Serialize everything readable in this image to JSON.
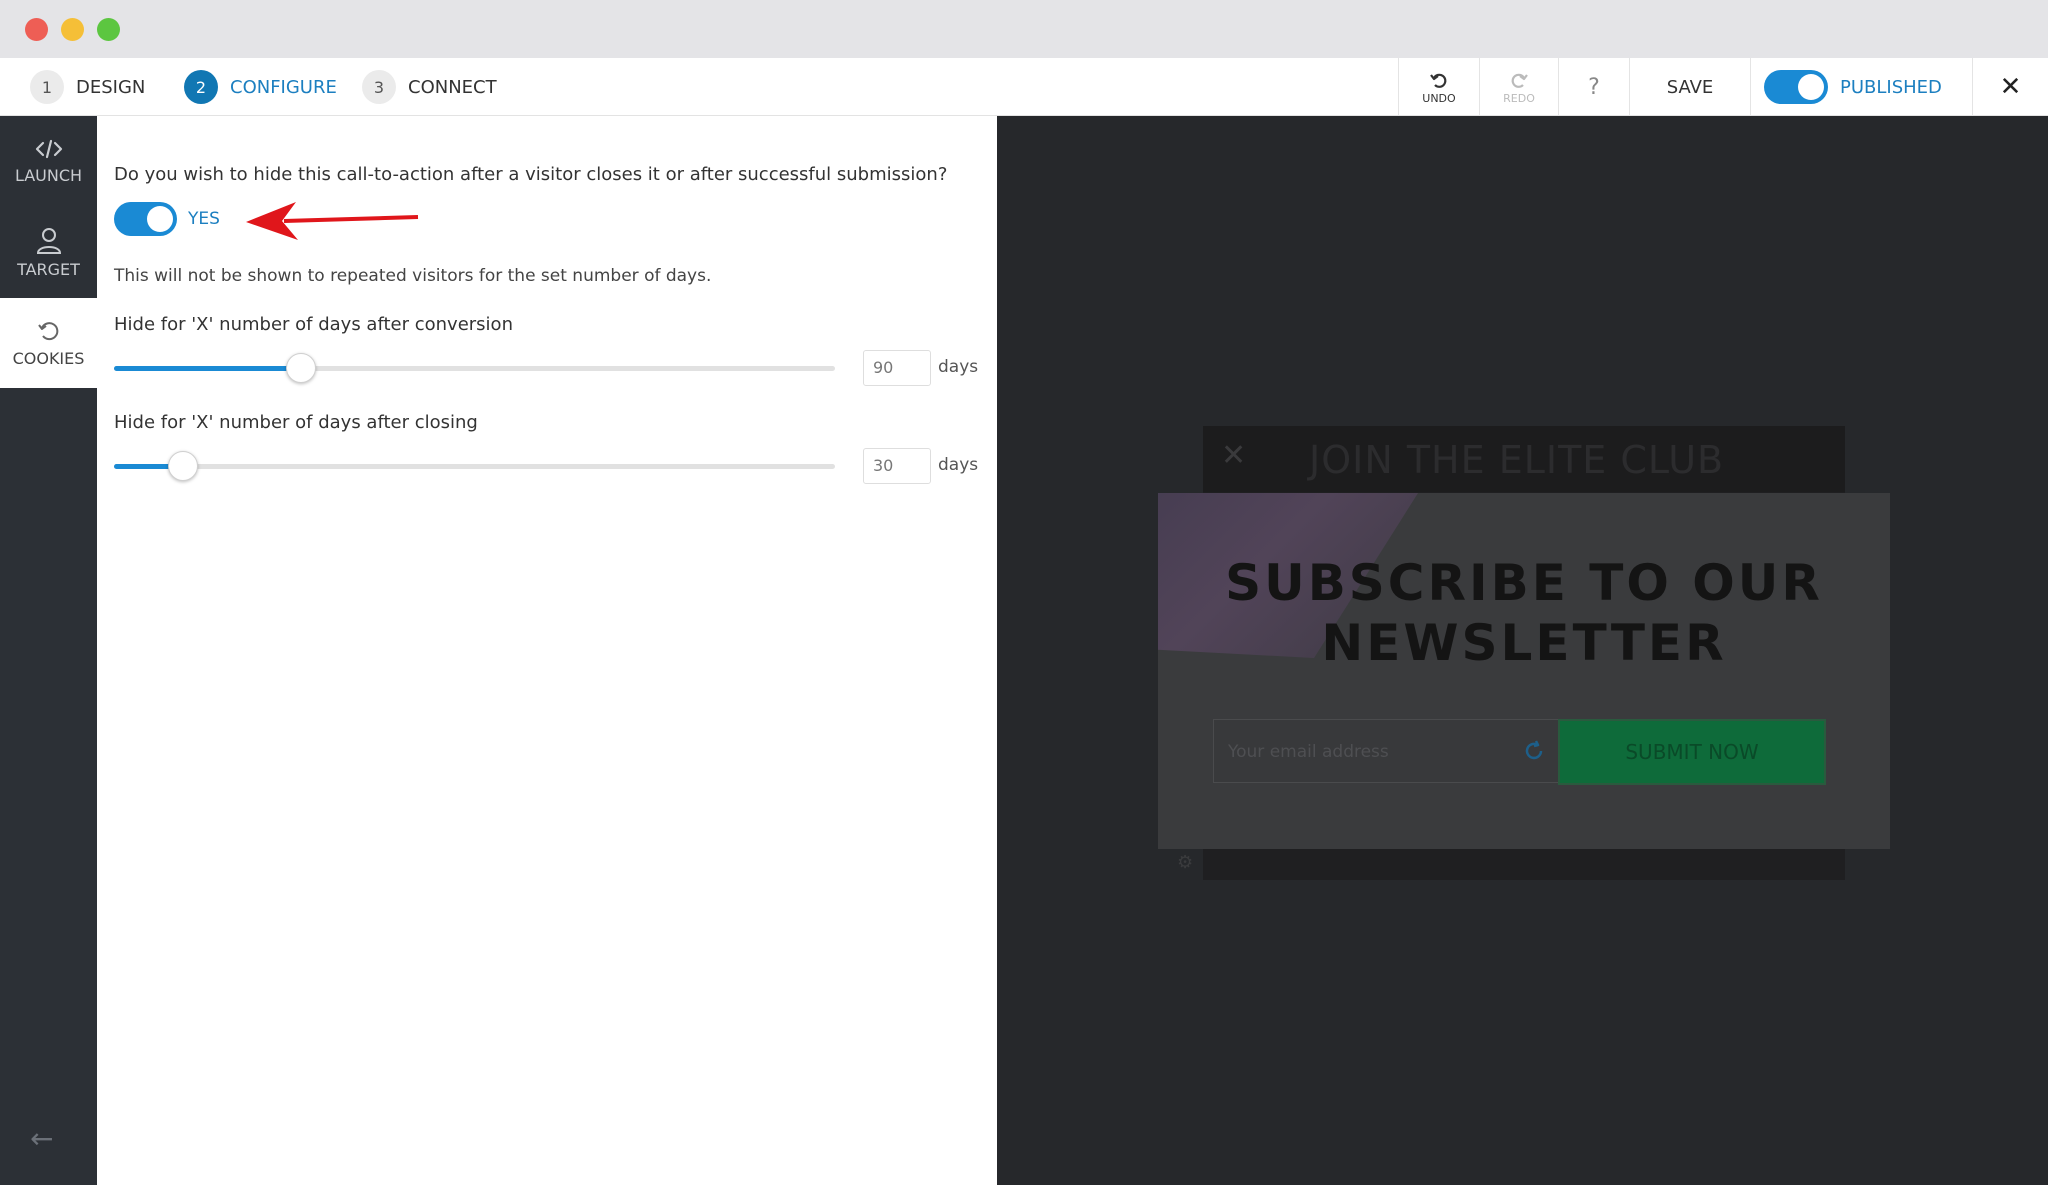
{
  "window": {
    "controls": [
      "close",
      "minimize",
      "maximize"
    ]
  },
  "steps": [
    {
      "num": "1",
      "label": "DESIGN"
    },
    {
      "num": "2",
      "label": "CONFIGURE"
    },
    {
      "num": "3",
      "label": "CONNECT"
    }
  ],
  "toolbar": {
    "undo_label": "UNDO",
    "redo_label": "REDO",
    "help_label": "?",
    "save_label": "SAVE",
    "published_label": "PUBLISHED",
    "published_on": true,
    "close_label": "✕"
  },
  "sidebar": {
    "items": [
      {
        "label": "LAUNCH",
        "icon": "code-icon"
      },
      {
        "label": "TARGET",
        "icon": "user-icon"
      },
      {
        "label": "COOKIES",
        "icon": "refresh-icon",
        "active": true
      }
    ],
    "back_icon": "arrow-left-icon"
  },
  "config": {
    "question": "Do you wish to hide this call-to-action after a visitor closes it or after successful submission?",
    "toggle_label": "YES",
    "toggle_on": true,
    "hint": "This will not be shown to repeated visitors for the set number of days.",
    "sliders": [
      {
        "title": "Hide for 'X' number of days after conversion",
        "value": "90",
        "unit": "days",
        "fraction": 0.26
      },
      {
        "title": "Hide for 'X' number of days after closing",
        "value": "30",
        "unit": "days",
        "fraction": 0.096
      }
    ]
  },
  "preview": {
    "header": "JOIN THE ELITE CLUB",
    "close_icon": "✕",
    "title": "SUBSCRIBE TO OUR NEWSLETTER",
    "email_placeholder": "Your email address",
    "submit_label": "SUBMIT NOW"
  },
  "colors": {
    "accent": "#1a8ad4",
    "sidebar_bg": "#2c3036",
    "preview_bg": "#26282b",
    "annotation": "#e0161b"
  }
}
